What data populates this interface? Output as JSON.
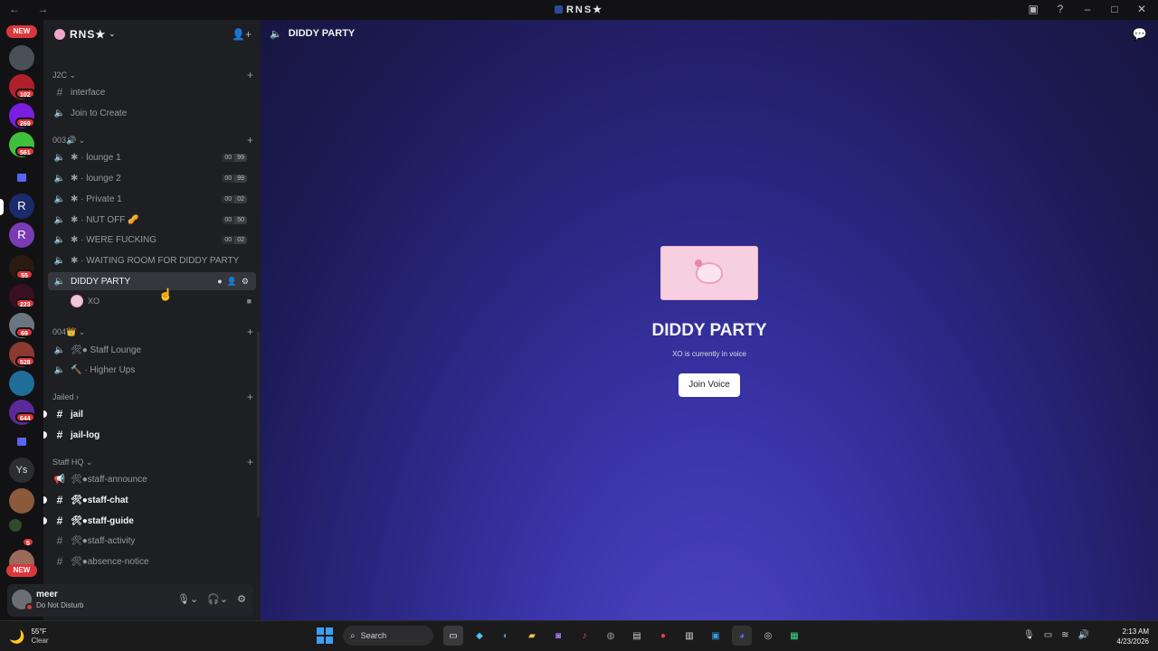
{
  "window": {
    "title": "RNS★",
    "nav": "← →"
  },
  "rail": {
    "new_label": "NEW",
    "badges": [
      "102",
      "269",
      "561",
      "55",
      "223",
      "69",
      "528",
      "644",
      "5"
    ],
    "ys_label": "Ys"
  },
  "server": {
    "name": "RNS★"
  },
  "categories": {
    "j2c": "J2C",
    "c003": "003🔊",
    "c004": "004👑",
    "jailed": "Jailed",
    "staff": "Staff HQ"
  },
  "channels": {
    "interface": "interface",
    "join_to_create": "Join to Create",
    "lounge1": "lounge 1",
    "lounge2": "lounge 2",
    "private1": "Private 1",
    "nutoff": "NUT OFF 🥜",
    "were": "WERE FUCKING",
    "waiting": "WAITING ROOM FOR DIDDY PARTY",
    "diddy": "DIDDY PARTY",
    "staff_lounge": "Staff Lounge",
    "higher_ups": "Higher Ups",
    "jail": "jail",
    "jail_log": "jail-log",
    "staff_announce": "🛠●staff-announce",
    "staff_chat": "🛠●staff-chat",
    "staff_guide": "🛠●staff-guide",
    "staff_activity": "🛠●staff-activity",
    "absence_notice": "🛠●absence-notice"
  },
  "limits": {
    "lounge1": [
      "00",
      "99"
    ],
    "lounge2": [
      "00",
      "99"
    ],
    "private1": [
      "00",
      "02"
    ],
    "nutoff": [
      "00",
      "50"
    ],
    "were": [
      "00",
      "02"
    ]
  },
  "voice_member": {
    "name": "XO"
  },
  "user": {
    "name": "meer",
    "status": "Do Not Disturb"
  },
  "main": {
    "channel_title": "DIDDY PARTY",
    "heading": "DIDDY PARTY",
    "subtitle": "XO is currently in voice",
    "join_button": "Join Voice"
  },
  "taskbar": {
    "temp": "55°F",
    "condition": "Clear",
    "search_placeholder": "Search",
    "time": "2:13 AM",
    "date": "4/23/2026"
  },
  "colors": {
    "accent": "#5865f2",
    "badge": "#da373c",
    "dnd": "#da373c"
  }
}
